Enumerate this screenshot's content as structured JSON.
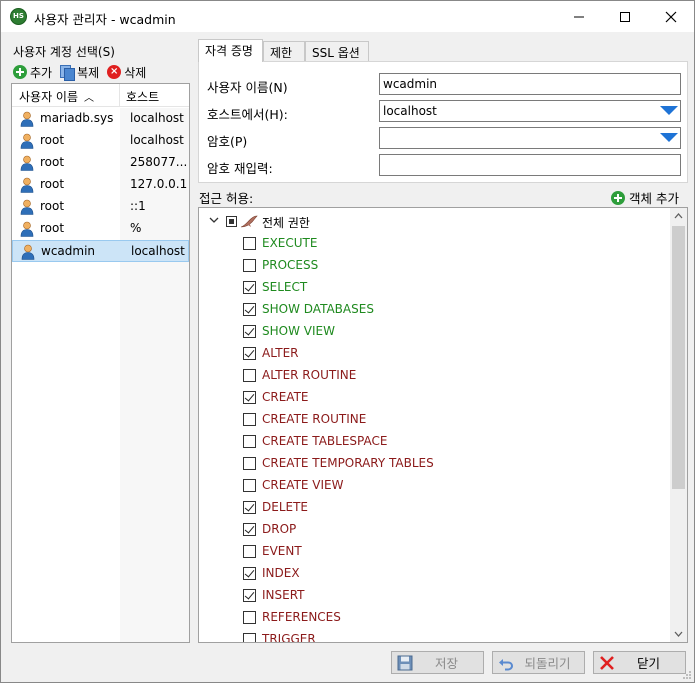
{
  "window": {
    "title": "사용자 관리자 - wcadmin",
    "app_icon_text": "HS"
  },
  "left": {
    "title": "사용자 계정 선택(S)",
    "toolbar": {
      "add_label": "추가",
      "copy_label": "복제",
      "delete_label": "삭제"
    },
    "columns": {
      "user": "사용자 이름",
      "host": "호스트"
    },
    "users": [
      {
        "name": "mariadb.sys",
        "host": "localhost"
      },
      {
        "name": "root",
        "host": "localhost"
      },
      {
        "name": "root",
        "host": "258077..."
      },
      {
        "name": "root",
        "host": "127.0.0.1"
      },
      {
        "name": "root",
        "host": "::1"
      },
      {
        "name": "root",
        "host": "%"
      },
      {
        "name": "wcadmin",
        "host": "localhost",
        "selected": true
      }
    ]
  },
  "tabs": [
    {
      "label": "자격 증명",
      "active": true
    },
    {
      "label": "제한",
      "active": false
    },
    {
      "label": "SSL 옵션",
      "active": false
    }
  ],
  "credentials": {
    "username_label": "사용자 이름(N)",
    "username_value": "wcadmin",
    "host_label": "호스트에서(H):",
    "host_value": "localhost",
    "password_label": "암호(P)",
    "password_value": "",
    "confirm_label": "암호 재입력:",
    "confirm_value": ""
  },
  "privileges": {
    "access_label": "접근 허용:",
    "add_object_label": "객체 추가",
    "root_label": "전체 권한",
    "items": [
      {
        "name": "EXECUTE",
        "checked": false,
        "color": "green"
      },
      {
        "name": "PROCESS",
        "checked": false,
        "color": "green"
      },
      {
        "name": "SELECT",
        "checked": true,
        "color": "green"
      },
      {
        "name": "SHOW DATABASES",
        "checked": true,
        "color": "green"
      },
      {
        "name": "SHOW VIEW",
        "checked": true,
        "color": "green"
      },
      {
        "name": "ALTER",
        "checked": true,
        "color": "red"
      },
      {
        "name": "ALTER ROUTINE",
        "checked": false,
        "color": "red"
      },
      {
        "name": "CREATE",
        "checked": true,
        "color": "red"
      },
      {
        "name": "CREATE ROUTINE",
        "checked": false,
        "color": "red"
      },
      {
        "name": "CREATE TABLESPACE",
        "checked": false,
        "color": "red"
      },
      {
        "name": "CREATE TEMPORARY TABLES",
        "checked": false,
        "color": "red"
      },
      {
        "name": "CREATE VIEW",
        "checked": false,
        "color": "red"
      },
      {
        "name": "DELETE",
        "checked": true,
        "color": "red"
      },
      {
        "name": "DROP",
        "checked": true,
        "color": "red"
      },
      {
        "name": "EVENT",
        "checked": false,
        "color": "red"
      },
      {
        "name": "INDEX",
        "checked": true,
        "color": "red"
      },
      {
        "name": "INSERT",
        "checked": true,
        "color": "red"
      },
      {
        "name": "REFERENCES",
        "checked": false,
        "color": "red"
      },
      {
        "name": "TRIGGER",
        "checked": false,
        "color": "red"
      }
    ]
  },
  "buttons": {
    "save_label": "저장",
    "revert_label": "되돌리기",
    "close_label": "닫기"
  },
  "colors": {
    "green_priv": "#1f8a1f",
    "red_priv": "#8b1a1a",
    "selection": "#cce4f7",
    "dropdown_arrow": "#1e73d6"
  }
}
